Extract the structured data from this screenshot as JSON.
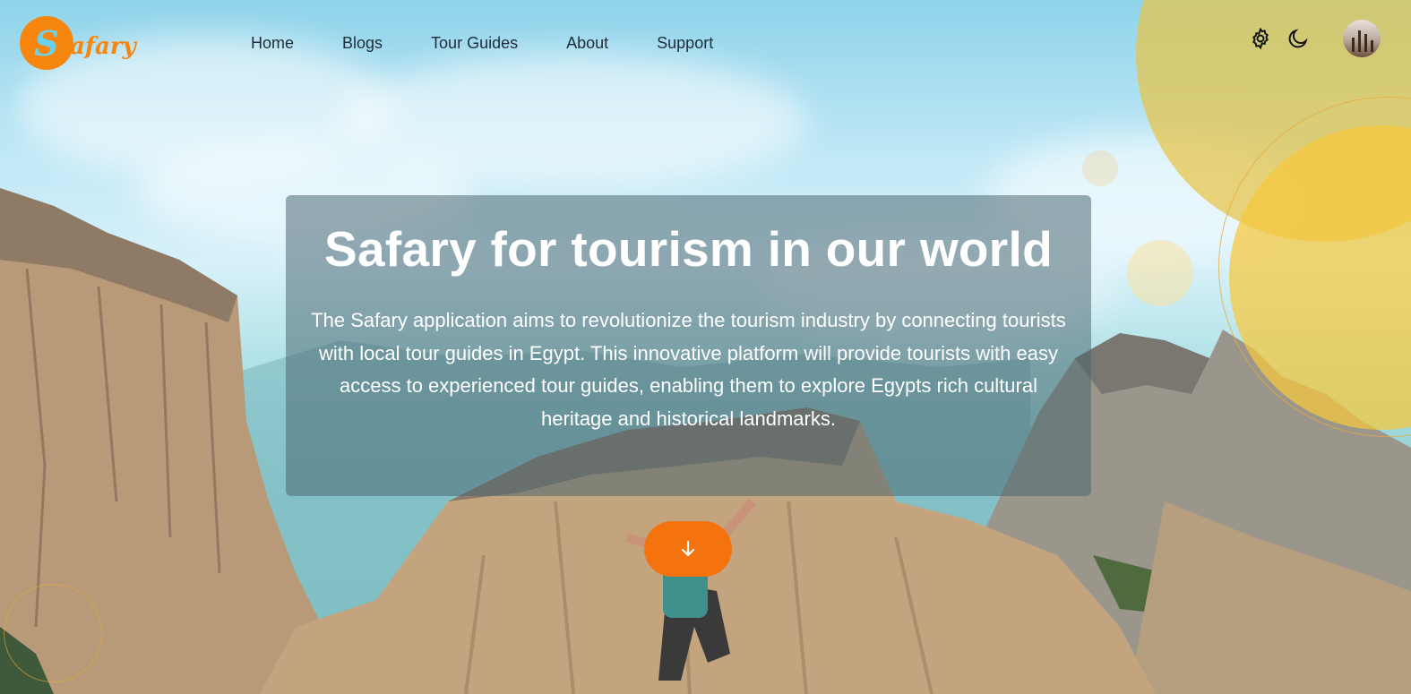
{
  "brand": {
    "logo_letter": "S",
    "name": "afary",
    "accent_color": "#f7860f"
  },
  "nav": {
    "links": [
      {
        "label": "Home"
      },
      {
        "label": "Blogs"
      },
      {
        "label": "Tour Guides"
      },
      {
        "label": "About"
      },
      {
        "label": "Support"
      }
    ],
    "icons": [
      "gear-icon",
      "moon-icon",
      "avatar"
    ]
  },
  "hero": {
    "title": "Safary for tourism in our world",
    "description": "The Safary application aims to revolutionize the tourism industry by connecting tourists with local tour guides in Egypt. This innovative platform will provide tourists with easy access to experienced tour guides, enabling them to explore Egypts rich cultural heritage and historical landmarks.",
    "scroll_button_icon": "arrow-down-icon",
    "button_color": "#f5730f"
  }
}
